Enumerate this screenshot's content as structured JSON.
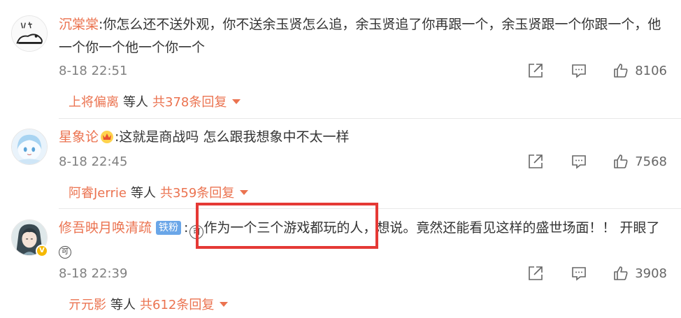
{
  "comments": [
    {
      "username": "沉棠棠",
      "text": ":你怎么还不送外观，你不送余玉贤怎么追，余玉贤追了你再跟一个，余玉贤跟一个你跟一个，他一个你一个他一个你一个",
      "timestamp": "8-18 22:51",
      "likes": "8106",
      "replies": {
        "name": "上将偏离",
        "mid": "等人",
        "count": "共378条回复"
      },
      "avatar_icon": "sketch-cat-avatar"
    },
    {
      "username": "星象论",
      "text": ":这就是商战吗 怎么跟我想象中不太一样",
      "timestamp": "8-18 22:45",
      "likes": "7568",
      "replies": {
        "name": "阿睿Jerrie",
        "mid": "等人",
        "count": "共359条回复"
      },
      "avatar_icon": "anime-girl-avatar",
      "badge_icon": "crown-icon"
    },
    {
      "username": "修吾映月唤清疏",
      "fan_badge": "铁粉",
      "text_before": ":",
      "emoji": "可",
      "text": "作为一个三个游戏都玩的人，想说。竟然还能看见这样的盛世场面！！ 开眼了",
      "emoji2": "可",
      "timestamp": "8-18 22:39",
      "likes": "3908",
      "replies": {
        "name": "亓元影",
        "mid": "等人",
        "count": "共612条回复"
      },
      "avatar_icon": "anime-boy-avatar",
      "verified": "V"
    }
  ],
  "colors": {
    "accent": "#eb7350",
    "highlight": "#e53935",
    "fan_badge": "#6aa6e8"
  }
}
